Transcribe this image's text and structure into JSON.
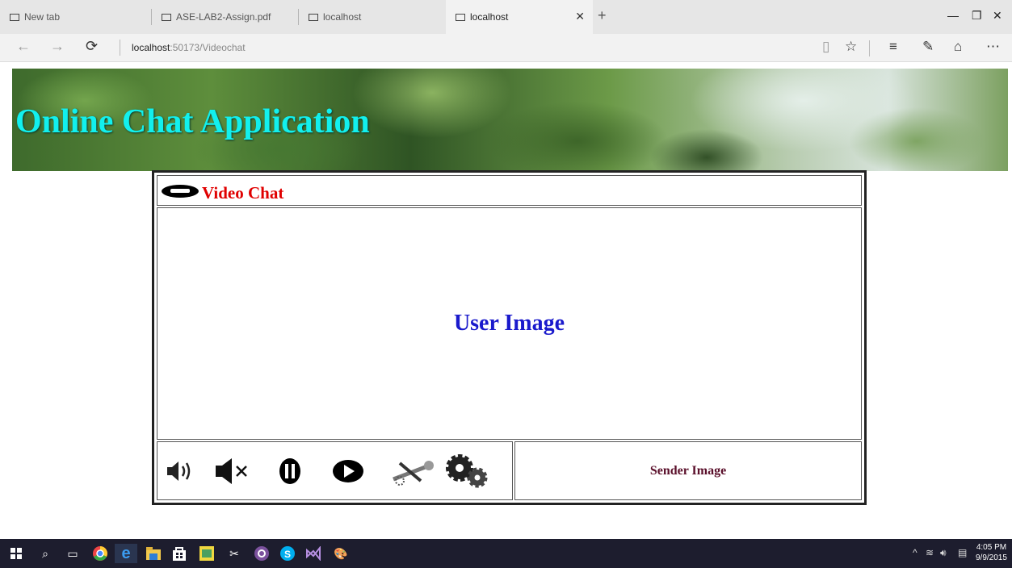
{
  "browser": {
    "tabs": [
      {
        "label": "New tab"
      },
      {
        "label": "ASE-LAB2-Assign.pdf"
      },
      {
        "label": "localhost"
      },
      {
        "label": "localhost",
        "active": true
      }
    ],
    "address": {
      "host": "localhost",
      "rest": ":50173/Videochat"
    }
  },
  "page": {
    "banner_title": "Online Chat Application",
    "panel_title": "Video Chat",
    "user_image_label": "User Image",
    "sender_image_label": "Sender Image"
  },
  "controls": {
    "icons": [
      "volume-icon",
      "mute-icon",
      "pause-icon",
      "play-icon",
      "tools-icon",
      "settings-gears-icon"
    ]
  },
  "taskbar": {
    "time": "4:05 PM",
    "date": "9/9/2015"
  },
  "colors": {
    "banner_title": "#12f0ee",
    "panel_title": "#e00000",
    "user_image": "#1a1acc",
    "sender_image": "#5a0f2a"
  }
}
